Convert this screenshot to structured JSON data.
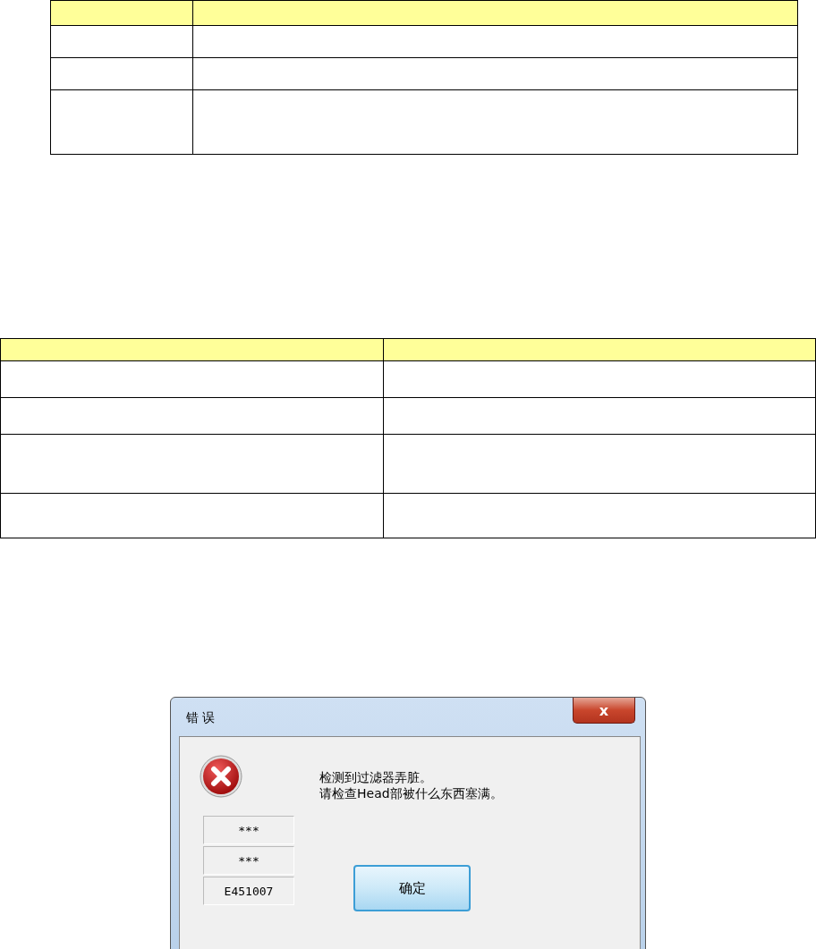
{
  "tables": [
    {
      "kind": "narrow",
      "rows": [
        {
          "kind": "header"
        },
        {
          "kind": "normal"
        },
        {
          "kind": "normal"
        },
        {
          "kind": "tall"
        }
      ]
    },
    {
      "kind": "wide",
      "rows": [
        {
          "kind": "header"
        },
        {
          "kind": "normal"
        },
        {
          "kind": "normal"
        },
        {
          "kind": "tall"
        },
        {
          "kind": "normal"
        }
      ]
    }
  ],
  "dialog": {
    "title": "错 误",
    "close": "x",
    "message": [
      "检测到过滤器弄脏。",
      "请检查Head部被什么东西塞满。"
    ],
    "codes": [
      "***",
      "***",
      "E451007"
    ],
    "button": "确定"
  }
}
